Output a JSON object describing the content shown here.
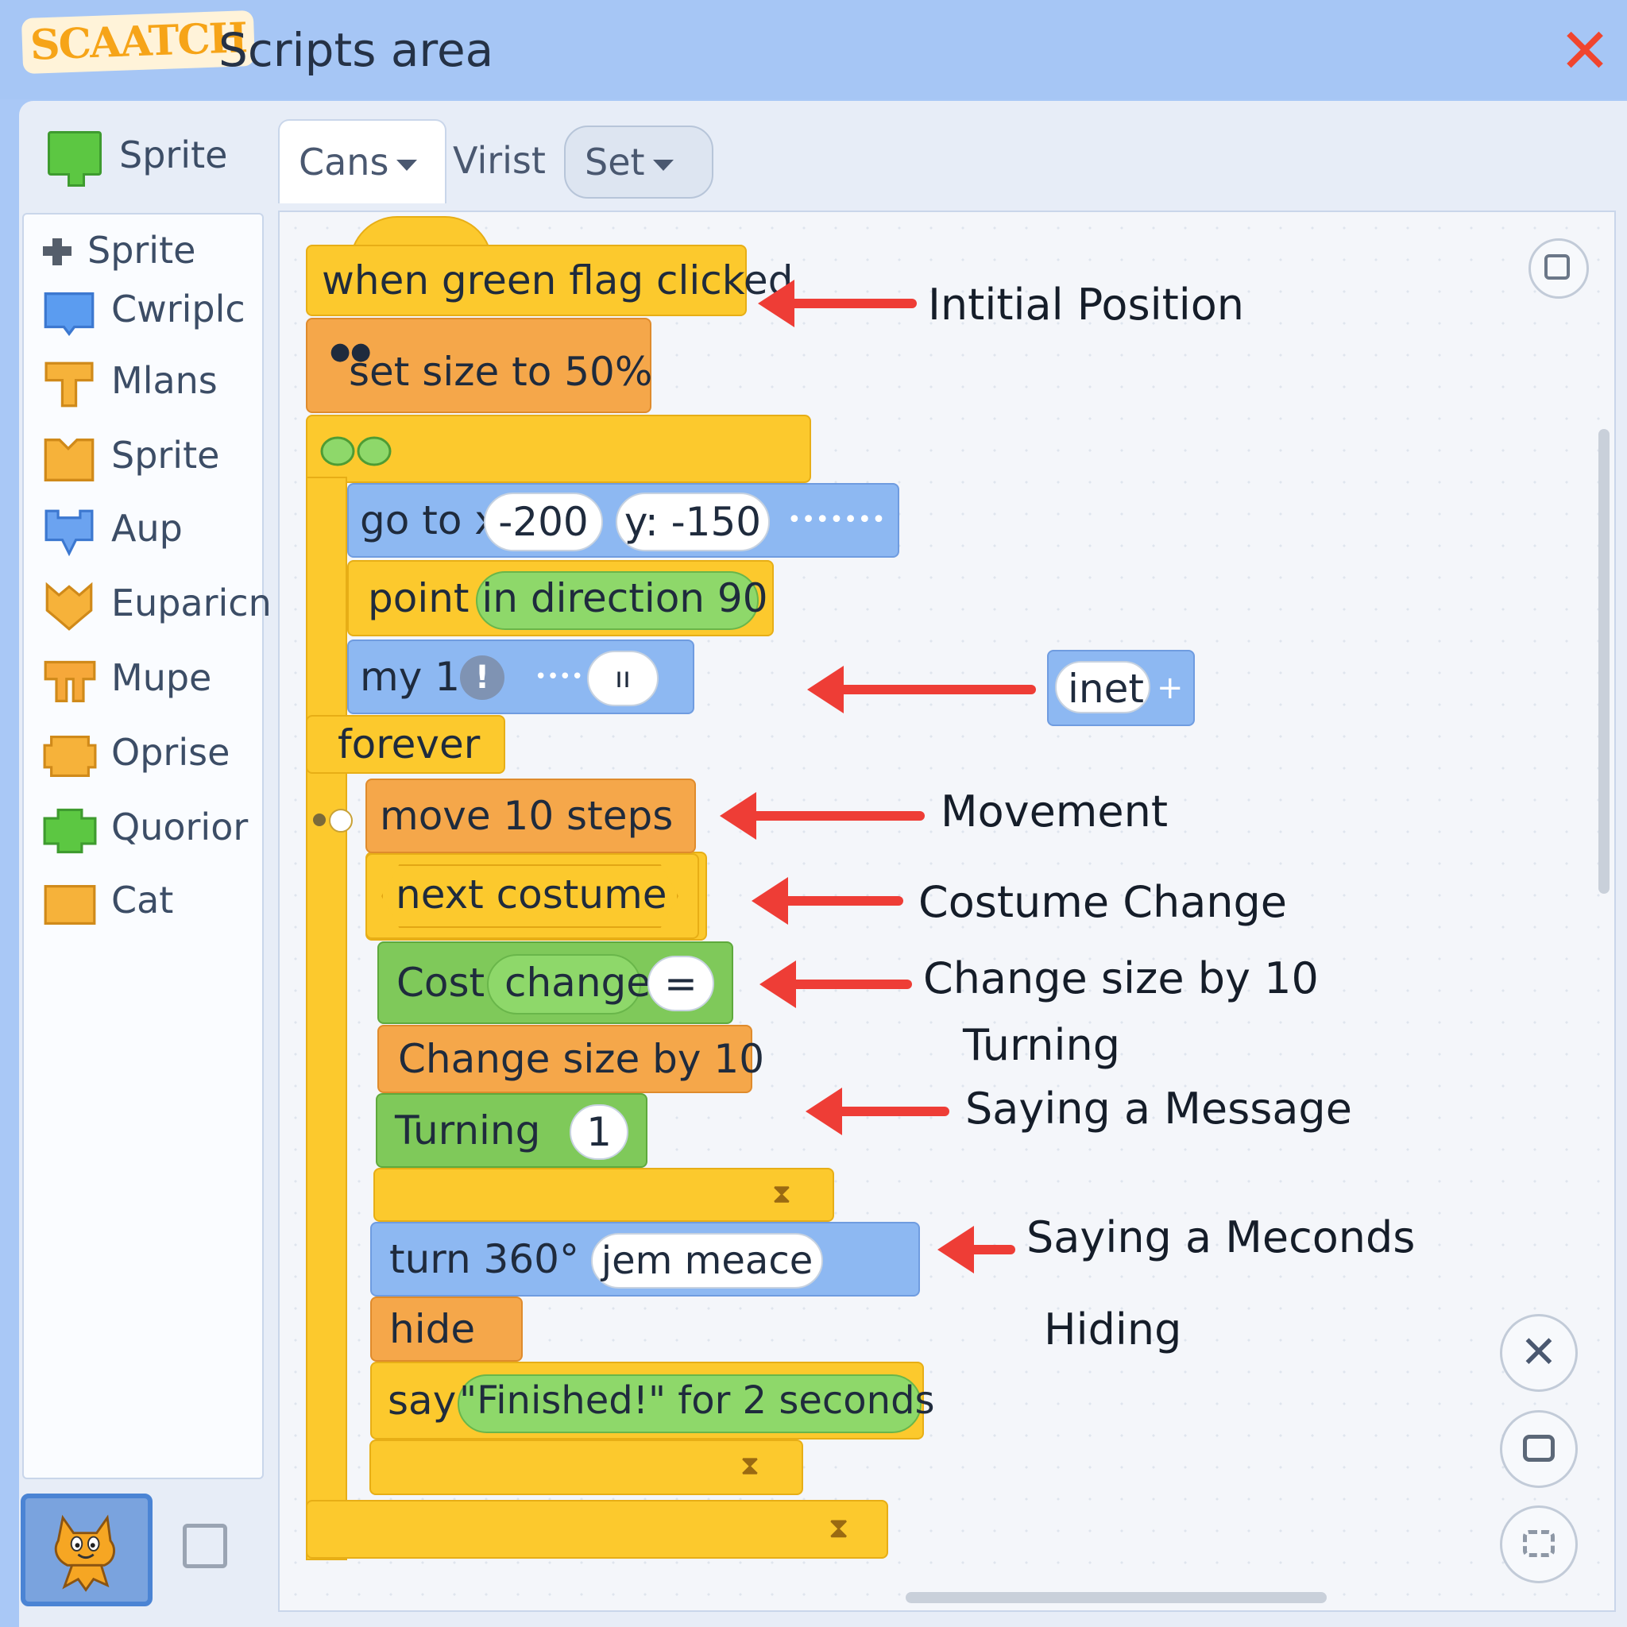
{
  "window": {
    "logo": "SCAATCH",
    "title": "Scripts area",
    "close_icon": "close-icon"
  },
  "sidebar": {
    "header_label": "Sprite",
    "categories": [
      {
        "label": "Sprite",
        "color": "#555e6b"
      },
      {
        "label": "Cwriplc",
        "color": "#5b9cf0"
      },
      {
        "label": "Mlans",
        "color": "#f6b23a"
      },
      {
        "label": "Sprite",
        "color": "#f6b23a"
      },
      {
        "label": "Aup",
        "color": "#6ba3f0"
      },
      {
        "label": "Euparicn",
        "color": "#f6b23a"
      },
      {
        "label": "Mupe",
        "color": "#f6a83a"
      },
      {
        "label": "Oprise",
        "color": "#f6b23a"
      },
      {
        "label": "Quorior",
        "color": "#5cc742"
      },
      {
        "label": "Cat",
        "color": "#f6b23a"
      }
    ]
  },
  "tabs": {
    "tab1": "Cans",
    "tab2": "Virist",
    "tab3": "Set"
  },
  "script": {
    "hat": "when green flag clicked",
    "set_size": "set size to 50%",
    "goto_label": "go to x:",
    "goto_x": "-200",
    "goto_y": "y: -150",
    "goto_dots": "•••••••",
    "point_dir": "point in direction 90",
    "my_label": "my 1",
    "my_badge": "!",
    "my_dots": "••••",
    "my_pill": "ıı",
    "forever": "forever",
    "move": "move 10 steps",
    "next_costume": "next costume",
    "cost_label": "Cost",
    "cost_change": "change",
    "cost_eq": "=",
    "change_size": "Change size by 10",
    "turning": "Turning",
    "turning_val": "1",
    "turn360": "turn 360°",
    "turn360_pill": "jem meace",
    "hide": "hide",
    "say_label": "say",
    "say_pill": "\"Finished!\" for 2 seconds",
    "floating_block": "inet",
    "floating_plus": "+"
  },
  "annotations": {
    "initial_position": "Intitial Position",
    "movement": "Movement",
    "costume_change": "Costume Change",
    "change_size": "Change size by 10",
    "turning": "Turning",
    "saying_message": "Saying a Message",
    "saying_meconds": "Saying a Meconds",
    "hiding": "Hiding"
  },
  "colors": {
    "event": "#fcc92d",
    "looks": "#f5a74a",
    "motion": "#8db8f2",
    "operators": "#7fc95a",
    "arrow": "#ee3d36",
    "accent_close": "#f0452e"
  }
}
